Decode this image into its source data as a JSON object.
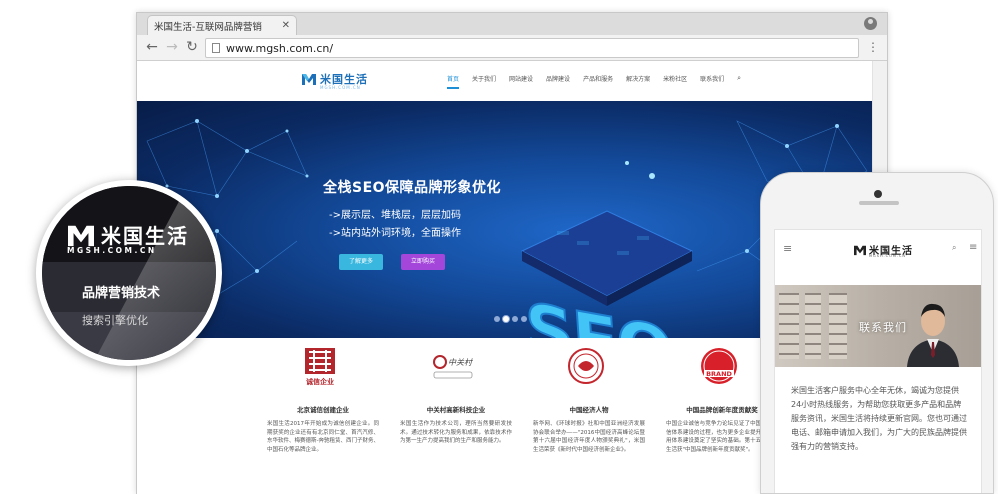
{
  "browser": {
    "tab_title": "米国生活-互联网品牌营销",
    "tab_close": "✕",
    "url": "www.mgsh.com.cn/",
    "back": "←",
    "forward": "→",
    "reload": "↻",
    "menu": "⋮"
  },
  "site": {
    "logo_text": "米国生活",
    "logo_sub": "MGSH.COM.CN",
    "nav": [
      "首页",
      "关于我们",
      "网站建设",
      "品牌建设",
      "产品和服务",
      "解决方案",
      "米粉社区",
      "联系我们"
    ],
    "search_icon": "⌕"
  },
  "hero": {
    "title": "全栈SEO保障品牌形象优化",
    "line1": "->展示层、堆栈层，层层加码",
    "line2": "->站内站外词环境，全面操作",
    "btn_more": "了解更多",
    "btn_buy": "立即购买",
    "art_text": "SEO",
    "slides": 4,
    "active_slide": 2
  },
  "partners": [
    {
      "name": "北京诚信创建企业",
      "logo_caption": "诚信企业",
      "desc": "米国生活2017年开始成为诚信创建企业。同期获奖的企业还有有北京同仁堂、首汽汽修、东华软件、梅赛德斯-奔驰租赁、西门子财务、中国石化等品牌企业。"
    },
    {
      "name": "中关村高新科技企业",
      "logo_caption": "中关村",
      "desc": "米国生活作为技术公司，理所当然要研发技术。通过技术转化为服务和成果，依靠技术作为第一生产力提高我们的生产和服务能力。"
    },
    {
      "name": "中国经济人物",
      "desc": "新华网、《环球时报》社和中国亚洲经济发展协会联合举办——\"2016中国经济高峰论坛暨第十六届中国经济年度人物颁奖典礼\"，米国生活荣获《新时代中国经济创新企业》。"
    },
    {
      "name": "中国品牌创新年度贡献奖",
      "logo_caption": "BRAND",
      "desc": "中国企业诚信与竞争力论坛见证了中国企业诚信体系建设的过程，也为更多企业提升社会信用体系建设奠定了坚实的基础。第十五届米国生活获\"中国品牌创新年度贡献奖\"。"
    }
  ],
  "badge": {
    "logo_text": "米国生活",
    "logo_sub": "MGSH.COM.CN",
    "title": "品牌营销技术",
    "subtitle": "搜索引擎优化"
  },
  "phone": {
    "logo_text": "米国生活",
    "logo_sub": "MGSH.COM.CN",
    "menu_icon": "≡",
    "search_icon": "⌕",
    "banner_title": "联系我们",
    "body_text": "米国生活客户服务中心全年无休，竭诚为您提供24小时热线服务，为帮助您获取更多产品和品牌服务资讯，米国生活将持续更新官网。您也可通过电话、邮箱申请加入我们，为广大的民族品牌提供强有力的营销支持。"
  },
  "colors": {
    "brand_blue": "#1d6fb8",
    "nav_active": "#1d8fd8",
    "btn_more": "#39b7de",
    "btn_buy": "#a346d9",
    "hero_dark": "#0b2a63"
  }
}
